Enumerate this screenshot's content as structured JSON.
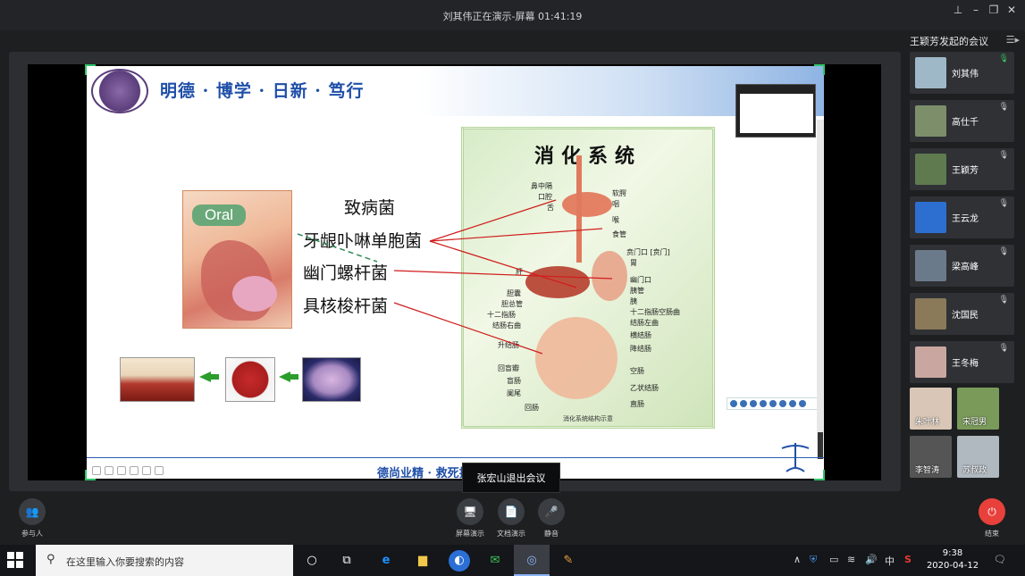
{
  "window": {
    "title": "刘其伟正在演示-屏幕 01:41:19",
    "controls": [
      "pin-icon",
      "minimize-icon",
      "restore-icon",
      "close-icon"
    ]
  },
  "slide": {
    "motto": "明德 · 博学 · 日新 · 笃行",
    "oral_label": "Oral",
    "pathogens": [
      "致病菌",
      "牙龈卟啉单胞菌",
      "幽门螺杆菌",
      "具核梭杆菌"
    ],
    "chart_title": "消化系统",
    "organ_labels_left": [
      "鼻中隔",
      "口腔",
      "舌",
      "肝",
      "胆囊",
      "胆总管",
      "十二指肠",
      "结肠右曲",
      "升结肠",
      "回盲瓣",
      "盲肠",
      "阑尾",
      "回肠"
    ],
    "organ_labels_right": [
      "软腭",
      "咽",
      "喉",
      "食管",
      "贲门口 [贲门]",
      "胃",
      "幽门口",
      "胰管",
      "胰",
      "十二指肠空肠曲",
      "结肠左曲",
      "横结肠",
      "降结肠",
      "空肠",
      "乙状结肠",
      "直肠"
    ],
    "chart_footer": "消化系统结构示意",
    "footer_text": "德尚业精 · 救死扶伤"
  },
  "toast": "张宏山退出会议",
  "sidebar": {
    "title": "王颖芳发起的会议",
    "participants": [
      {
        "name": "刘其伟",
        "color": "#9fb8c8",
        "mic": "on"
      },
      {
        "name": "高仕千",
        "color": "#7d8f6a",
        "mic": "off"
      },
      {
        "name": "王颖芳",
        "color": "#5f7a4f",
        "mic": "off"
      },
      {
        "name": "王云龙",
        "color": "#2d6fd0",
        "mic": "off"
      },
      {
        "name": "梁高峰",
        "color": "#6b7a8a",
        "mic": "off"
      },
      {
        "name": "沈国民",
        "color": "#8a7a5a",
        "mic": "off"
      },
      {
        "name": "王冬梅",
        "color": "#c9a7a0",
        "mic": "off"
      }
    ],
    "grid": [
      {
        "name": "朱叶林",
        "color": "#d9c6b6"
      },
      {
        "name": "宋冠男",
        "color": "#7a9a5a"
      },
      {
        "name": "李智涛",
        "color": "#555555"
      },
      {
        "name": "苏叔政",
        "color": "#b0b8c0"
      }
    ]
  },
  "controls": {
    "participants": "参与人",
    "screen_share": "屏幕演示",
    "doc_share": "文档演示",
    "mute": "静音",
    "end": "结束"
  },
  "taskbar": {
    "search_placeholder": "在这里输入你要搜索的内容",
    "ime": "中",
    "time": "9:38",
    "date": "2020-04-12"
  }
}
